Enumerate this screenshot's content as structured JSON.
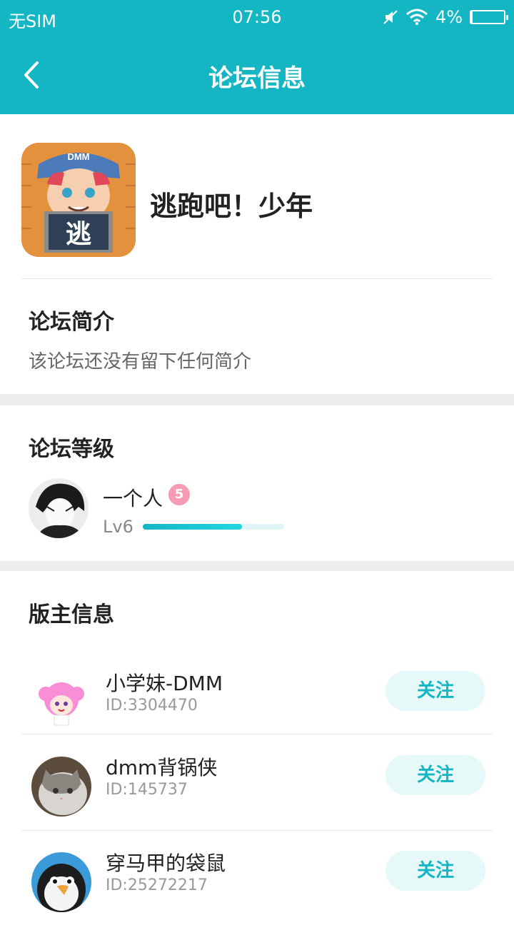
{
  "status_bar": {
    "carrier": "无SIM",
    "time": "07:56",
    "battery_text": "4%",
    "battery_level": 0.04
  },
  "nav": {
    "title": "论坛信息"
  },
  "game": {
    "name": "逃跑吧！少年",
    "icon_text": "逃",
    "icon_cap_text": "DMM"
  },
  "intro": {
    "title": "论坛简介",
    "text": "该论坛还没有留下任何简介"
  },
  "level": {
    "title": "论坛等级",
    "user_name": "一个人",
    "badge": "5",
    "level_label": "Lv6",
    "progress": 0.7
  },
  "moderators": {
    "title": "版主信息",
    "follow_label": "关注",
    "items": [
      {
        "name": "小学妹-DMM",
        "id": "ID:3304470"
      },
      {
        "name": "dmm背锅侠",
        "id": "ID:145737"
      },
      {
        "name": "穿马甲的袋鼠",
        "id": "ID:25272217"
      }
    ]
  },
  "colors": {
    "primary": "#14b6c4",
    "follow_bg": "#e7f8f8",
    "badge_pink": "#f59bb4"
  }
}
